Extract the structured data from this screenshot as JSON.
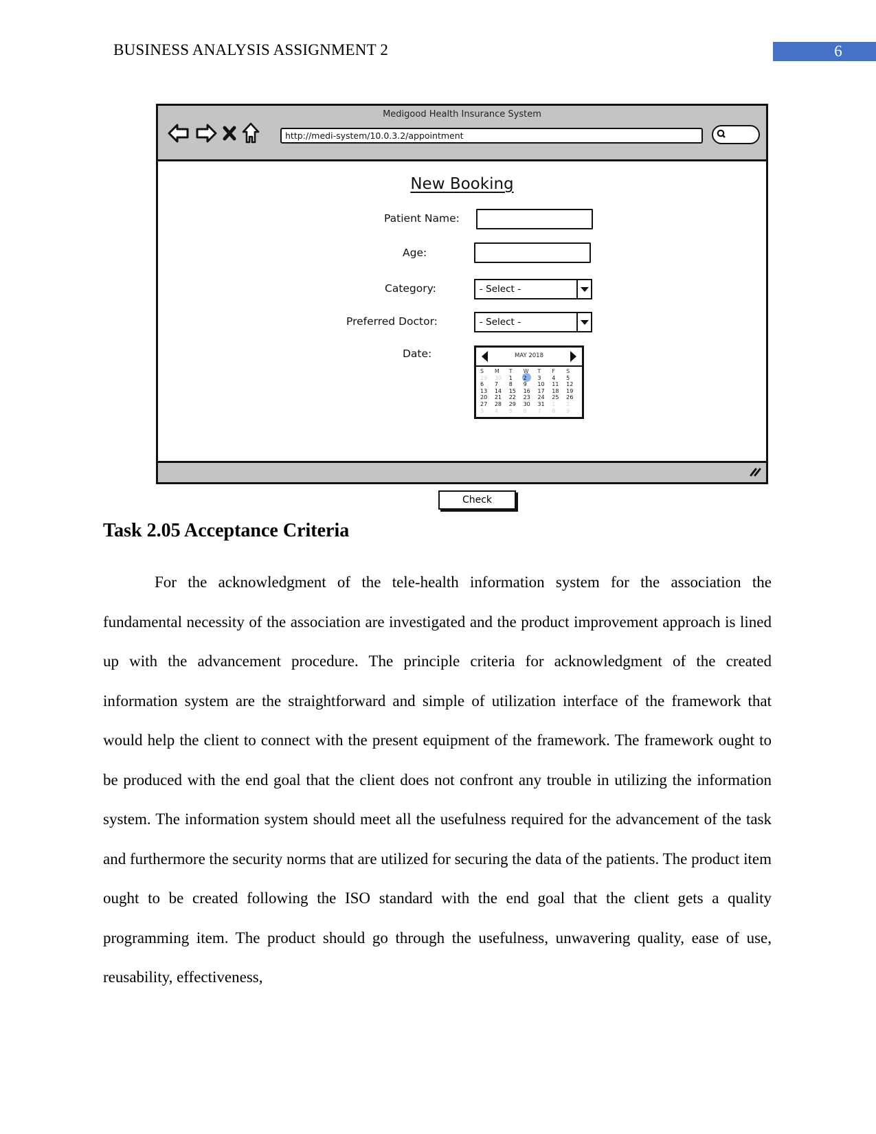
{
  "header": {
    "running_head": "BUSINESS ANALYSIS ASSIGNMENT 2",
    "page_number": "6",
    "accent_color": "#4472c4"
  },
  "wireframe": {
    "window_title": "Medigood Health Insurance System",
    "nav_icons": [
      "back-arrow-icon",
      "forward-arrow-icon",
      "close-x-icon",
      "home-icon"
    ],
    "url": "http://medi-system/10.0.3.2/appointment",
    "search_icon": "search-icon",
    "form": {
      "title": "New Booking",
      "patient_name_label": "Patient Name:",
      "patient_name_value": "",
      "age_label": "Age:",
      "age_value": "",
      "category_label": "Category:",
      "category_value": "- Select -",
      "doctor_label": "Preferred Doctor:",
      "doctor_value": "- Select -",
      "date_label": "Date:",
      "check_button": "Check"
    },
    "calendar": {
      "month": "MAY 2018",
      "weekdays": [
        "S",
        "M",
        "T",
        "W",
        "T",
        "F",
        "S"
      ],
      "selected_day": "2",
      "highlight_color": "#8fb3ea",
      "days": [
        {
          "d": "29",
          "muted": true
        },
        {
          "d": "30",
          "muted": true
        },
        {
          "d": "1"
        },
        {
          "d": "2",
          "selected": true
        },
        {
          "d": "3"
        },
        {
          "d": "4"
        },
        {
          "d": "5"
        },
        {
          "d": "6"
        },
        {
          "d": "7"
        },
        {
          "d": "8"
        },
        {
          "d": "9"
        },
        {
          "d": "10"
        },
        {
          "d": "11"
        },
        {
          "d": "12"
        },
        {
          "d": "13"
        },
        {
          "d": "14"
        },
        {
          "d": "15"
        },
        {
          "d": "16"
        },
        {
          "d": "17"
        },
        {
          "d": "18"
        },
        {
          "d": "19"
        },
        {
          "d": "20"
        },
        {
          "d": "21"
        },
        {
          "d": "22"
        },
        {
          "d": "23"
        },
        {
          "d": "24"
        },
        {
          "d": "25"
        },
        {
          "d": "26"
        },
        {
          "d": "27"
        },
        {
          "d": "28"
        },
        {
          "d": "29"
        },
        {
          "d": "30"
        },
        {
          "d": "31"
        },
        {
          "d": "1",
          "muted": true
        },
        {
          "d": "2",
          "muted": true
        },
        {
          "d": "3",
          "muted": true
        },
        {
          "d": "4",
          "muted": true
        },
        {
          "d": "5",
          "muted": true
        },
        {
          "d": "6",
          "muted": true
        },
        {
          "d": "7",
          "muted": true
        },
        {
          "d": "8",
          "muted": true
        },
        {
          "d": "9",
          "muted": true
        }
      ]
    }
  },
  "section": {
    "heading": "Task 2.05 Acceptance Criteria",
    "paragraph": "For the acknowledgment of the tele-health information system for the association the fundamental necessity of the association are investigated and the product improvement approach is lined up with the advancement procedure. The principle criteria for acknowledgment of the created information system are the straightforward and simple of utilization interface of the framework that would help the client to connect with the present equipment of the framework. The framework ought to be produced with the end goal that the client does not confront any trouble in utilizing the information system. The information system should meet all the usefulness required for the advancement of the task and furthermore the security norms that are utilized for securing the data of the patients. The product item ought to be created following the ISO standard with the end goal that the client gets a quality programming item. The product should go through the usefulness, unwavering quality, ease of use, reusability, effectiveness,"
  }
}
